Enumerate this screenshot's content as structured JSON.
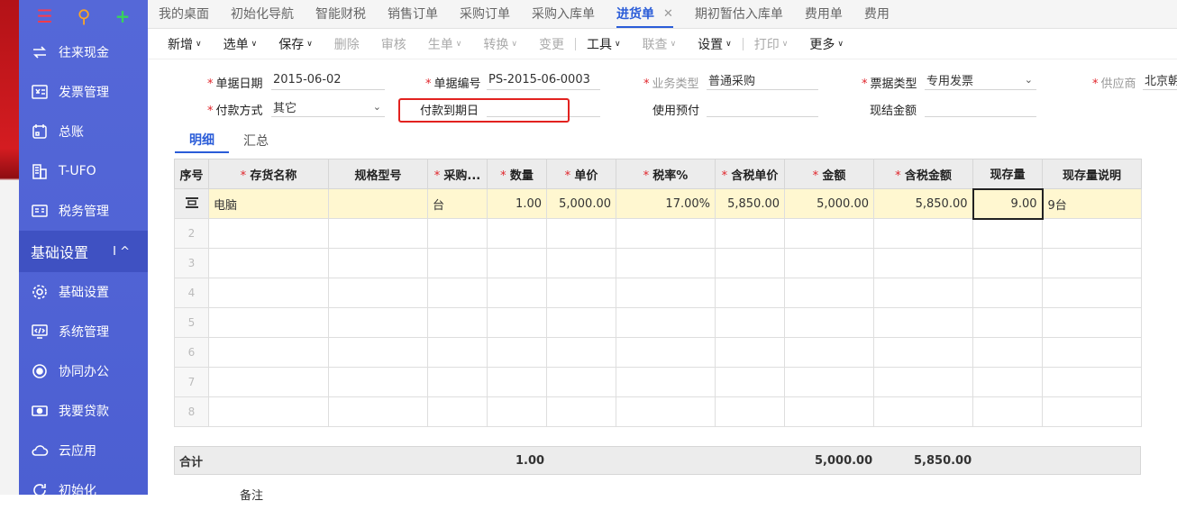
{
  "sidebar": {
    "top_icons": [
      "menu-icon",
      "search-icon",
      "add-icon"
    ],
    "items": [
      {
        "label": "往来现金",
        "icon": "exchange-icon"
      },
      {
        "label": "发票管理",
        "icon": "invoice-icon"
      },
      {
        "label": "总账",
        "icon": "ledger-icon"
      },
      {
        "label": "T-UFO",
        "icon": "building-icon"
      },
      {
        "label": "税务管理",
        "icon": "tax-icon"
      }
    ],
    "section": {
      "label": "基础设置",
      "collapse": "I ^"
    },
    "items2": [
      {
        "label": "基础设置",
        "icon": "settings-icon"
      },
      {
        "label": "系统管理",
        "icon": "monitor-code-icon"
      },
      {
        "label": "协同办公",
        "icon": "collab-icon"
      },
      {
        "label": "我要贷款",
        "icon": "money-icon"
      },
      {
        "label": "云应用",
        "icon": "cloud-icon"
      },
      {
        "label": "初始化",
        "icon": "refresh-icon"
      }
    ]
  },
  "tabs": [
    "我的桌面",
    "初始化导航",
    "智能财税",
    "销售订单",
    "采购订单",
    "采购入库单",
    "进货单",
    "期初暂估入库单",
    "费用单",
    "费用"
  ],
  "active_tab": "进货单",
  "toolbar": [
    {
      "label": "新增",
      "caret": "∨",
      "disabled": false
    },
    {
      "label": "选单",
      "caret": "∨",
      "disabled": false
    },
    {
      "label": "保存",
      "caret": "∨",
      "disabled": false
    },
    {
      "label": "删除",
      "caret": "",
      "disabled": true
    },
    {
      "label": "审核",
      "caret": "",
      "disabled": true
    },
    {
      "label": "生单",
      "caret": "∨",
      "disabled": true
    },
    {
      "label": "转换",
      "caret": "∨",
      "disabled": true
    },
    {
      "label": "变更",
      "caret": "",
      "disabled": true
    },
    {
      "label": "工具",
      "caret": "∨",
      "disabled": false
    },
    {
      "label": "联查",
      "caret": "∨",
      "disabled": true
    },
    {
      "label": "设置",
      "caret": "∨",
      "disabled": false
    },
    {
      "label": "打印",
      "caret": "∨",
      "disabled": true
    },
    {
      "label": "更多",
      "caret": "∨",
      "disabled": false
    }
  ],
  "form": {
    "doc_date": {
      "label": "单据日期",
      "value": "2015-06-02"
    },
    "doc_no": {
      "label": "单据编号",
      "value": "PS-2015-06-0003"
    },
    "biz_type": {
      "label": "业务类型",
      "value": "普通采购"
    },
    "invoice_type": {
      "label": "票据类型",
      "value": "专用发票"
    },
    "supplier": {
      "label": "供应商",
      "value": "北京朝"
    },
    "pay_method": {
      "label": "付款方式",
      "value": "其它"
    },
    "due_date": {
      "label": "付款到期日",
      "value": ""
    },
    "prepay": {
      "label": "使用预付",
      "value": ""
    },
    "cash_amount": {
      "label": "现结金额",
      "value": ""
    }
  },
  "subtabs": [
    "明细",
    "汇总"
  ],
  "grid": {
    "headers": [
      "序号",
      "存货名称",
      "规格型号",
      "采购...",
      "数量",
      "单价",
      "税率%",
      "含税单价",
      "金额",
      "含税金额",
      "现存量",
      "现存量说明"
    ],
    "rows": [
      [
        "",
        "电脑",
        "",
        "台",
        "1.00",
        "5,000.00",
        "17.00%",
        "5,850.00",
        "5,000.00",
        "5,850.00",
        "9.00",
        "9台"
      ],
      [
        "2",
        "",
        "",
        "",
        "",
        "",
        "",
        "",
        "",
        "",
        "",
        ""
      ],
      [
        "3",
        "",
        "",
        "",
        "",
        "",
        "",
        "",
        "",
        "",
        "",
        ""
      ],
      [
        "4",
        "",
        "",
        "",
        "",
        "",
        "",
        "",
        "",
        "",
        "",
        ""
      ],
      [
        "5",
        "",
        "",
        "",
        "",
        "",
        "",
        "",
        "",
        "",
        "",
        ""
      ],
      [
        "6",
        "",
        "",
        "",
        "",
        "",
        "",
        "",
        "",
        "",
        "",
        ""
      ],
      [
        "7",
        "",
        "",
        "",
        "",
        "",
        "",
        "",
        "",
        "",
        "",
        ""
      ],
      [
        "8",
        "",
        "",
        "",
        "",
        "",
        "",
        "",
        "",
        "",
        "",
        ""
      ]
    ]
  },
  "totals": {
    "label": "合计",
    "qty": "1.00",
    "amount": "5,000.00",
    "tax_amount": "5,850.00"
  },
  "remark_label": "备注",
  "colors": {
    "sidebar": "#4c5fd2",
    "accent": "#2a5cd8",
    "highlight": "#e2221f",
    "selected_row": "#fff7d0"
  }
}
